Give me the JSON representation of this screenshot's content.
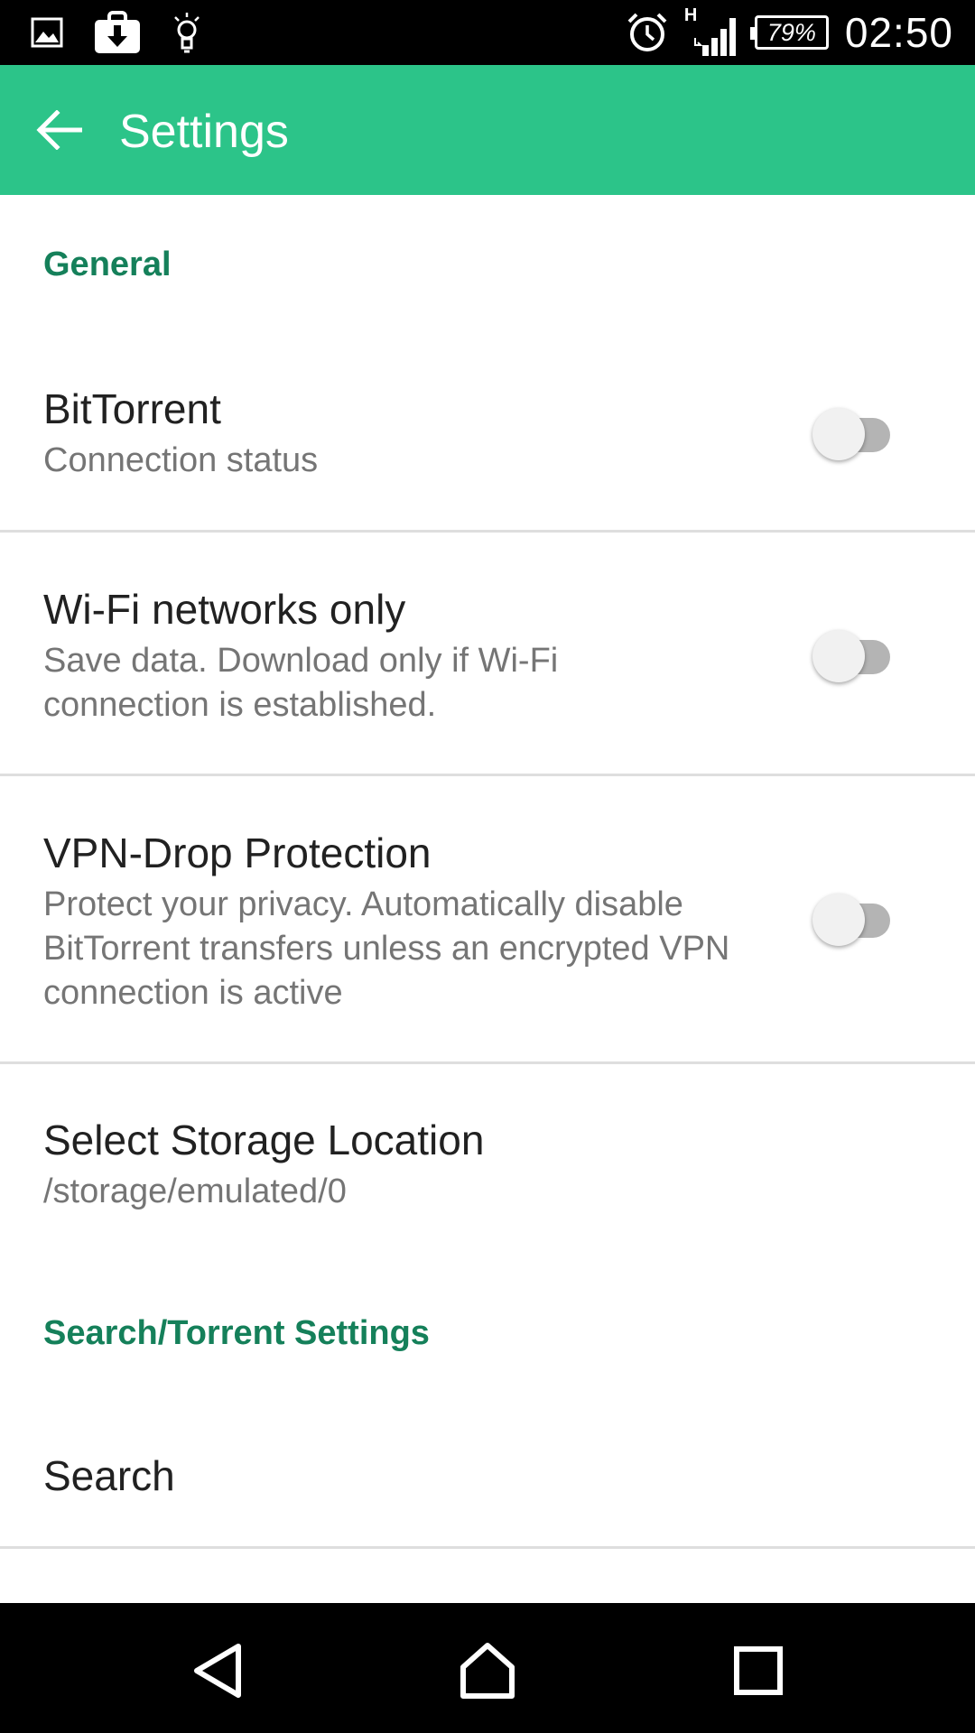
{
  "status_bar": {
    "icons_left": [
      "image-icon",
      "download-bag-icon",
      "lightbulb-icon"
    ],
    "icons_right": [
      "alarm-icon",
      "hspa-signal-icon"
    ],
    "network_type": "H",
    "battery_level": "79%",
    "time": "02:50"
  },
  "app_bar": {
    "title": "Settings",
    "background_color": "#2cc489"
  },
  "sections": {
    "general": {
      "header": "General",
      "items": {
        "bittorrent": {
          "title": "BitTorrent",
          "summary": "Connection status",
          "enabled": false
        },
        "wifi_only": {
          "title": "Wi-Fi networks only",
          "summary": "Save data. Download only if Wi-Fi connection is established.",
          "enabled": false
        },
        "vpn_drop": {
          "title": "VPN-Drop Protection",
          "summary": "Protect your privacy. Automatically disable BitTorrent transfers unless an encrypted VPN connection is active",
          "enabled": false
        },
        "storage": {
          "title": "Select Storage Location",
          "summary": "/storage/emulated/0"
        }
      }
    },
    "search_torrent": {
      "header": "Search/Torrent Settings",
      "items": {
        "search": {
          "title": "Search"
        }
      }
    }
  },
  "colors": {
    "accent": "#2cc489",
    "section_header": "#15805a"
  },
  "nav_bar": {
    "buttons": [
      "back-triangle-icon",
      "home-icon",
      "recents-square-icon"
    ]
  }
}
